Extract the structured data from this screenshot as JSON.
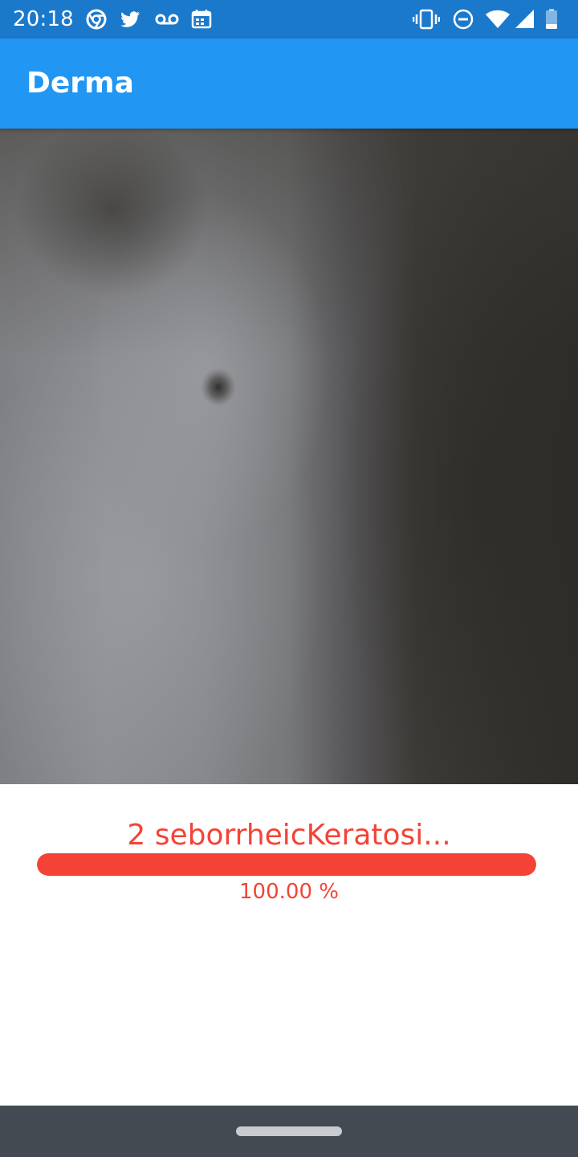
{
  "status_bar": {
    "time": "20:18",
    "icons_left": [
      "chrome-icon",
      "twitter-icon",
      "voicemail-icon",
      "calendar-icon"
    ],
    "icons_right": [
      "vibrate-icon",
      "do-not-disturb-icon",
      "wifi-icon",
      "signal-icon",
      "battery-icon"
    ],
    "color": "#1b79cc"
  },
  "app_bar": {
    "title": "Derma",
    "color": "#2196f3"
  },
  "result": {
    "label": "2 seborrheicKeratosi...",
    "confidence_text": "100.00 %",
    "confidence_value": 1.0,
    "accent_color": "#f44336"
  },
  "nav_bar": {
    "color": "#434a52"
  }
}
